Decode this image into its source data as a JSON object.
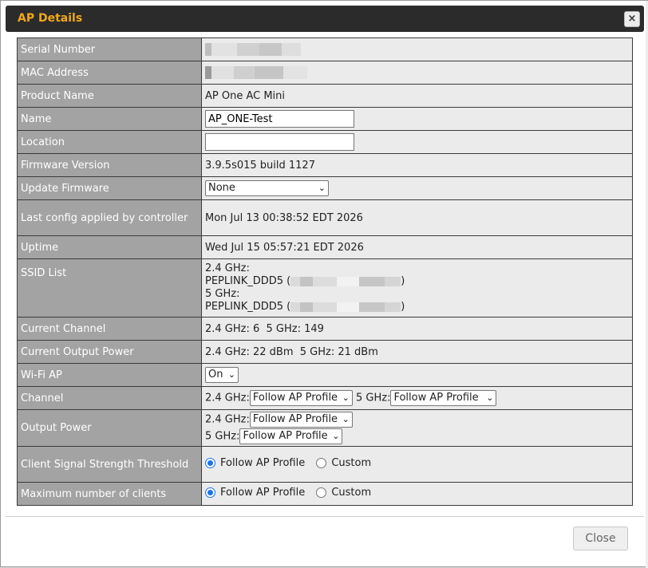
{
  "dialog": {
    "title": "AP Details",
    "close_icon": "×",
    "close_button": "Close"
  },
  "rows": {
    "serial_number": {
      "label": "Serial Number"
    },
    "mac_address": {
      "label": "MAC Address"
    },
    "product_name": {
      "label": "Product Name",
      "value": "AP One AC Mini"
    },
    "name": {
      "label": "Name",
      "value": "AP_ONE-Test"
    },
    "location": {
      "label": "Location",
      "value": ""
    },
    "firmware_version": {
      "label": "Firmware Version",
      "value": "3.9.5s015 build 1127"
    },
    "update_firmware": {
      "label": "Update Firmware",
      "selected": "None"
    },
    "last_config": {
      "label": "Last config applied by controller",
      "value": "Mon Jul 13 00:38:52 EDT 2026"
    },
    "uptime": {
      "label": "Uptime",
      "value": "Wed Jul 15 05:57:21 EDT 2026"
    },
    "ssid_list": {
      "label": "SSID List",
      "band1": "2.4 GHz:",
      "ssid1": "PEPLINK_DDD5 (",
      "close1": ")",
      "band2": "5 GHz:",
      "ssid2": "PEPLINK_DDD5 (",
      "close2": ")"
    },
    "current_channel": {
      "label": "Current Channel",
      "value": "2.4 GHz: 6  5 GHz: 149"
    },
    "current_output_power": {
      "label": "Current Output Power",
      "value": "2.4 GHz: 22 dBm  5 GHz: 21 dBm"
    },
    "wifi_ap": {
      "label": "Wi-Fi AP",
      "selected": "On"
    },
    "channel": {
      "label": "Channel",
      "band1": "2.4 GHz:",
      "select1": "Follow AP Profile",
      "band2": "5 GHz:",
      "select2": "Follow AP Profile"
    },
    "output_power": {
      "label": "Output Power",
      "band1": "2.4 GHz:",
      "select1": "Follow AP Profile",
      "band2": "5 GHz:",
      "select2": "Follow AP Profile"
    },
    "client_signal": {
      "label": "Client Signal Strength Threshold",
      "option1": "Follow AP Profile",
      "option2": "Custom",
      "selected": "Follow AP Profile"
    },
    "max_clients": {
      "label": "Maximum number of clients",
      "option1": "Follow AP Profile",
      "option2": "Custom",
      "selected": "Follow AP Profile"
    }
  },
  "colors": {
    "title_text": "#f0a81c",
    "titlebar_bg": "#2b2b2b",
    "label_bg": "#a3a3a3",
    "value_bg": "#ebebeb",
    "radio_accent": "#1a73e8"
  }
}
